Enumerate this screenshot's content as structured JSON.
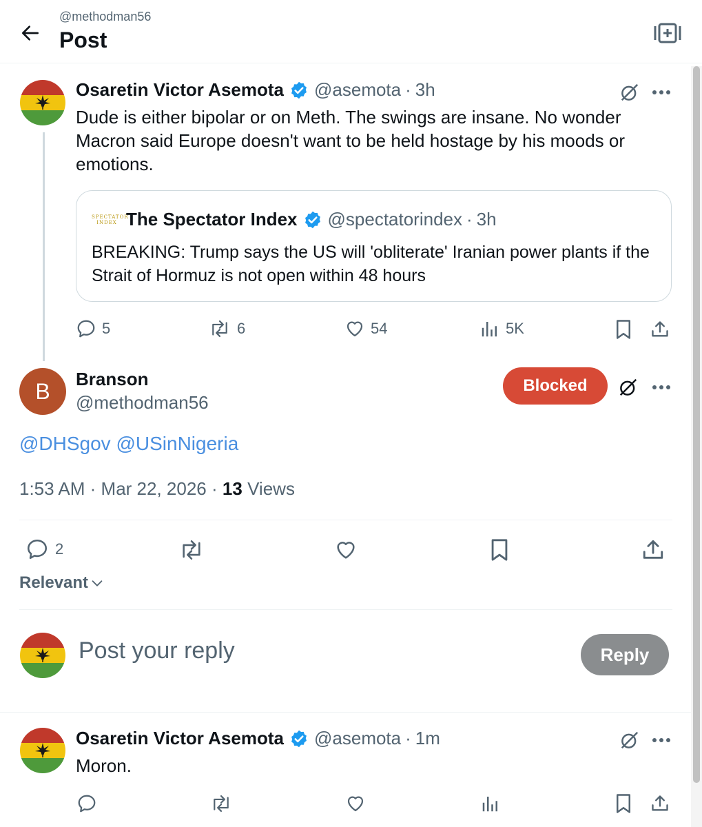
{
  "header": {
    "subtitle": "@methodman56",
    "title": "Post"
  },
  "parent_post": {
    "name": "Osaretin Victor Asemota",
    "handle": "@asemota",
    "dot": "·",
    "time": "3h",
    "text": "Dude is either bipolar or on Meth. The swings are insane. No wonder Macron said Europe doesn't want to be held hostage by his moods or emotions.",
    "quote": {
      "logo_text": "SPECTATOR INDEX",
      "name": "The Spectator Index",
      "handle": "@spectatorindex",
      "dot": "·",
      "time": "3h",
      "text": "BREAKING: Trump says the US will 'obliterate' Iranian power plants if the Strait of Hormuz is not open within 48 hours"
    },
    "actions": {
      "replies": "5",
      "reposts": "6",
      "likes": "54",
      "views": "5K"
    }
  },
  "main_post": {
    "avatar_letter": "B",
    "name": "Branson",
    "handle": "@methodman56",
    "blocked_label": "Blocked",
    "mentions": [
      "@DHSgov",
      "@USinNigeria"
    ],
    "time": "1:53 AM",
    "dot": "·",
    "date": "Mar 22, 2026",
    "dot2": "·",
    "views_count": "13",
    "views_label": "Views",
    "actions": {
      "replies": "2"
    }
  },
  "sort": {
    "label": "Relevant"
  },
  "reply_box": {
    "placeholder": "Post your reply",
    "button": "Reply"
  },
  "reply_post": {
    "name": "Osaretin Victor Asemota",
    "handle": "@asemota",
    "dot": "·",
    "time": "1m",
    "text": "Moron."
  },
  "colors": {
    "accent": "#1d9bf0",
    "mention": "#4a8fe0",
    "blocked": "#d74a36",
    "reply_button": "#8a8d8f",
    "flag_red": "#c0392b",
    "flag_yellow": "#f1c40f",
    "flag_green": "#4e9a3b"
  },
  "icons": [
    "back-arrow-icon",
    "add-to-reader-icon",
    "verified-badge-icon",
    "grok-icon",
    "more-icon",
    "reply-icon",
    "repost-icon",
    "like-icon",
    "views-icon",
    "bookmark-icon",
    "share-icon",
    "chevron-down-icon"
  ]
}
